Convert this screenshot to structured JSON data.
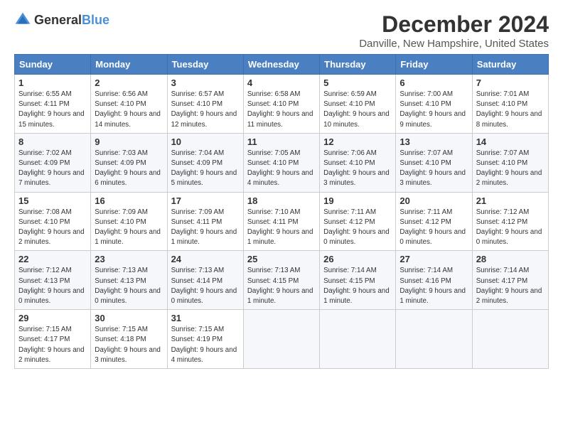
{
  "logo": {
    "general": "General",
    "blue": "Blue"
  },
  "title": "December 2024",
  "subtitle": "Danville, New Hampshire, United States",
  "header": {
    "days": [
      "Sunday",
      "Monday",
      "Tuesday",
      "Wednesday",
      "Thursday",
      "Friday",
      "Saturday"
    ]
  },
  "weeks": [
    [
      {
        "day": "1",
        "sunrise": "Sunrise: 6:55 AM",
        "sunset": "Sunset: 4:11 PM",
        "daylight": "Daylight: 9 hours and 15 minutes."
      },
      {
        "day": "2",
        "sunrise": "Sunrise: 6:56 AM",
        "sunset": "Sunset: 4:10 PM",
        "daylight": "Daylight: 9 hours and 14 minutes."
      },
      {
        "day": "3",
        "sunrise": "Sunrise: 6:57 AM",
        "sunset": "Sunset: 4:10 PM",
        "daylight": "Daylight: 9 hours and 12 minutes."
      },
      {
        "day": "4",
        "sunrise": "Sunrise: 6:58 AM",
        "sunset": "Sunset: 4:10 PM",
        "daylight": "Daylight: 9 hours and 11 minutes."
      },
      {
        "day": "5",
        "sunrise": "Sunrise: 6:59 AM",
        "sunset": "Sunset: 4:10 PM",
        "daylight": "Daylight: 9 hours and 10 minutes."
      },
      {
        "day": "6",
        "sunrise": "Sunrise: 7:00 AM",
        "sunset": "Sunset: 4:10 PM",
        "daylight": "Daylight: 9 hours and 9 minutes."
      },
      {
        "day": "7",
        "sunrise": "Sunrise: 7:01 AM",
        "sunset": "Sunset: 4:10 PM",
        "daylight": "Daylight: 9 hours and 8 minutes."
      }
    ],
    [
      {
        "day": "8",
        "sunrise": "Sunrise: 7:02 AM",
        "sunset": "Sunset: 4:09 PM",
        "daylight": "Daylight: 9 hours and 7 minutes."
      },
      {
        "day": "9",
        "sunrise": "Sunrise: 7:03 AM",
        "sunset": "Sunset: 4:09 PM",
        "daylight": "Daylight: 9 hours and 6 minutes."
      },
      {
        "day": "10",
        "sunrise": "Sunrise: 7:04 AM",
        "sunset": "Sunset: 4:09 PM",
        "daylight": "Daylight: 9 hours and 5 minutes."
      },
      {
        "day": "11",
        "sunrise": "Sunrise: 7:05 AM",
        "sunset": "Sunset: 4:10 PM",
        "daylight": "Daylight: 9 hours and 4 minutes."
      },
      {
        "day": "12",
        "sunrise": "Sunrise: 7:06 AM",
        "sunset": "Sunset: 4:10 PM",
        "daylight": "Daylight: 9 hours and 3 minutes."
      },
      {
        "day": "13",
        "sunrise": "Sunrise: 7:07 AM",
        "sunset": "Sunset: 4:10 PM",
        "daylight": "Daylight: 9 hours and 3 minutes."
      },
      {
        "day": "14",
        "sunrise": "Sunrise: 7:07 AM",
        "sunset": "Sunset: 4:10 PM",
        "daylight": "Daylight: 9 hours and 2 minutes."
      }
    ],
    [
      {
        "day": "15",
        "sunrise": "Sunrise: 7:08 AM",
        "sunset": "Sunset: 4:10 PM",
        "daylight": "Daylight: 9 hours and 2 minutes."
      },
      {
        "day": "16",
        "sunrise": "Sunrise: 7:09 AM",
        "sunset": "Sunset: 4:10 PM",
        "daylight": "Daylight: 9 hours and 1 minute."
      },
      {
        "day": "17",
        "sunrise": "Sunrise: 7:09 AM",
        "sunset": "Sunset: 4:11 PM",
        "daylight": "Daylight: 9 hours and 1 minute."
      },
      {
        "day": "18",
        "sunrise": "Sunrise: 7:10 AM",
        "sunset": "Sunset: 4:11 PM",
        "daylight": "Daylight: 9 hours and 1 minute."
      },
      {
        "day": "19",
        "sunrise": "Sunrise: 7:11 AM",
        "sunset": "Sunset: 4:12 PM",
        "daylight": "Daylight: 9 hours and 0 minutes."
      },
      {
        "day": "20",
        "sunrise": "Sunrise: 7:11 AM",
        "sunset": "Sunset: 4:12 PM",
        "daylight": "Daylight: 9 hours and 0 minutes."
      },
      {
        "day": "21",
        "sunrise": "Sunrise: 7:12 AM",
        "sunset": "Sunset: 4:12 PM",
        "daylight": "Daylight: 9 hours and 0 minutes."
      }
    ],
    [
      {
        "day": "22",
        "sunrise": "Sunrise: 7:12 AM",
        "sunset": "Sunset: 4:13 PM",
        "daylight": "Daylight: 9 hours and 0 minutes."
      },
      {
        "day": "23",
        "sunrise": "Sunrise: 7:13 AM",
        "sunset": "Sunset: 4:13 PM",
        "daylight": "Daylight: 9 hours and 0 minutes."
      },
      {
        "day": "24",
        "sunrise": "Sunrise: 7:13 AM",
        "sunset": "Sunset: 4:14 PM",
        "daylight": "Daylight: 9 hours and 0 minutes."
      },
      {
        "day": "25",
        "sunrise": "Sunrise: 7:13 AM",
        "sunset": "Sunset: 4:15 PM",
        "daylight": "Daylight: 9 hours and 1 minute."
      },
      {
        "day": "26",
        "sunrise": "Sunrise: 7:14 AM",
        "sunset": "Sunset: 4:15 PM",
        "daylight": "Daylight: 9 hours and 1 minute."
      },
      {
        "day": "27",
        "sunrise": "Sunrise: 7:14 AM",
        "sunset": "Sunset: 4:16 PM",
        "daylight": "Daylight: 9 hours and 1 minute."
      },
      {
        "day": "28",
        "sunrise": "Sunrise: 7:14 AM",
        "sunset": "Sunset: 4:17 PM",
        "daylight": "Daylight: 9 hours and 2 minutes."
      }
    ],
    [
      {
        "day": "29",
        "sunrise": "Sunrise: 7:15 AM",
        "sunset": "Sunset: 4:17 PM",
        "daylight": "Daylight: 9 hours and 2 minutes."
      },
      {
        "day": "30",
        "sunrise": "Sunrise: 7:15 AM",
        "sunset": "Sunset: 4:18 PM",
        "daylight": "Daylight: 9 hours and 3 minutes."
      },
      {
        "day": "31",
        "sunrise": "Sunrise: 7:15 AM",
        "sunset": "Sunset: 4:19 PM",
        "daylight": "Daylight: 9 hours and 4 minutes."
      },
      null,
      null,
      null,
      null
    ]
  ]
}
